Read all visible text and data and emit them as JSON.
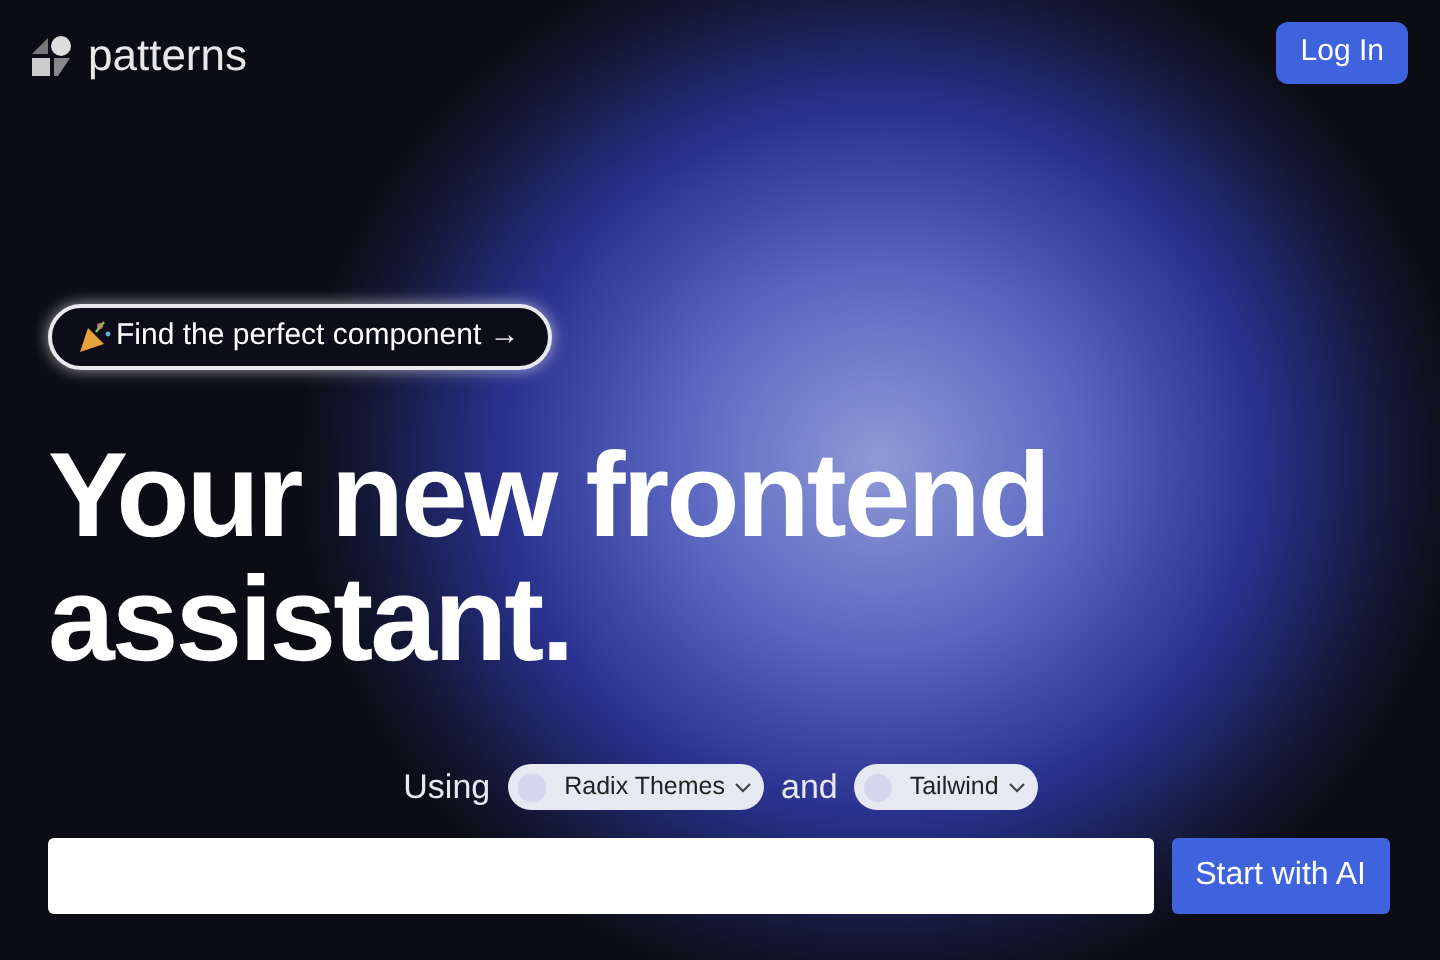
{
  "header": {
    "brand": "patterns",
    "login_button": "Log In"
  },
  "announcement": {
    "label": "Find the perfect component →"
  },
  "headline": [
    "Your new frontend",
    "assistant."
  ],
  "stack_picker": {
    "prefix": "Using",
    "joiner": "and",
    "choices": [
      {
        "label": "Radix Themes"
      },
      {
        "label": "Tailwind"
      }
    ]
  },
  "prompt": {
    "submit": "Start with AI"
  }
}
